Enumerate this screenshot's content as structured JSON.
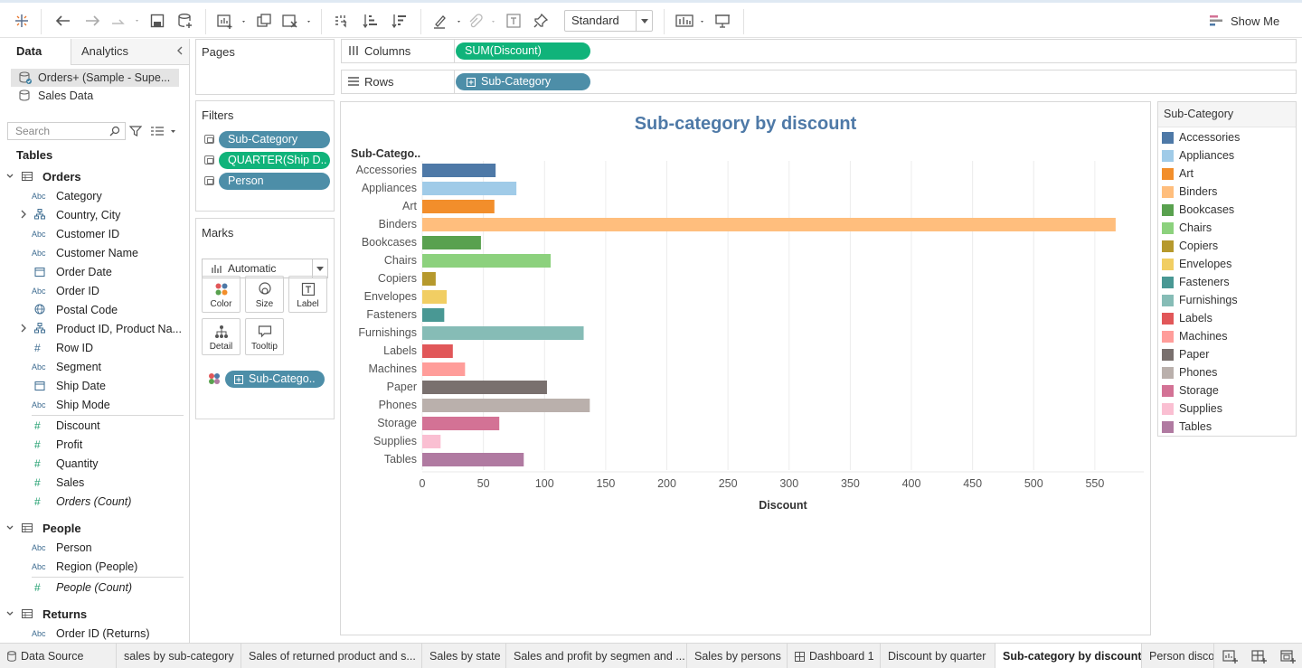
{
  "toolbar": {
    "mark_type_select": "Standard",
    "show_me": "Show Me"
  },
  "left_pane": {
    "tab_data": "Data",
    "tab_analytics": "Analytics",
    "data_sources": [
      "Orders+ (Sample - Supe...",
      "Sales Data"
    ],
    "search_placeholder": "Search",
    "tables_heading": "Tables",
    "tables": [
      {
        "name": "Orders",
        "fields": [
          {
            "type": "Abc",
            "name": "Category"
          },
          {
            "type": "geo",
            "name": "Country, City",
            "expand": true
          },
          {
            "type": "Abc",
            "name": "Customer ID"
          },
          {
            "type": "Abc",
            "name": "Customer Name"
          },
          {
            "type": "date",
            "name": "Order Date"
          },
          {
            "type": "Abc",
            "name": "Order ID"
          },
          {
            "type": "globe",
            "name": "Postal Code"
          },
          {
            "type": "geo",
            "name": "Product ID, Product Na...",
            "expand": true
          },
          {
            "type": "#",
            "name": "Row ID"
          },
          {
            "type": "Abc",
            "name": "Segment"
          },
          {
            "type": "date",
            "name": "Ship Date"
          },
          {
            "type": "Abc",
            "name": "Ship Mode"
          }
        ],
        "measures": [
          "Discount",
          "Profit",
          "Quantity",
          "Sales",
          "Orders (Count)"
        ]
      },
      {
        "name": "People",
        "fields": [
          {
            "type": "Abc",
            "name": "Person"
          },
          {
            "type": "Abc",
            "name": "Region (People)"
          }
        ],
        "measures": [
          "People (Count)"
        ]
      },
      {
        "name": "Returns",
        "fields": [
          {
            "type": "Abc",
            "name": "Order ID (Returns)"
          }
        ],
        "measures": []
      }
    ]
  },
  "cards": {
    "pages": "Pages",
    "filters": "Filters",
    "filter_pills": [
      "Sub-Category",
      "QUARTER(Ship D..",
      "Person"
    ],
    "marks": "Marks",
    "mark_type": "Automatic",
    "mark_buttons": [
      "Color",
      "Size",
      "Label",
      "Detail",
      "Tooltip"
    ],
    "marks_pill": "Sub-Catego.."
  },
  "shelves": {
    "columns_label": "Columns",
    "columns_pill": "SUM(Discount)",
    "rows_label": "Rows",
    "rows_pill": "Sub-Category"
  },
  "chart_data": {
    "type": "bar",
    "orientation": "horizontal",
    "title": "Sub-category by discount",
    "row_header": "Sub-Catego..",
    "xlabel": "Discount",
    "xlim": [
      0,
      590
    ],
    "xticks": [
      0,
      50,
      100,
      150,
      200,
      250,
      300,
      350,
      400,
      450,
      500,
      550
    ],
    "grid": true,
    "categories": [
      "Accessories",
      "Appliances",
      "Art",
      "Binders",
      "Bookcases",
      "Chairs",
      "Copiers",
      "Envelopes",
      "Fasteners",
      "Furnishings",
      "Labels",
      "Machines",
      "Paper",
      "Phones",
      "Storage",
      "Supplies",
      "Tables"
    ],
    "values": [
      60,
      77,
      59,
      567,
      48,
      105,
      11,
      20,
      18,
      132,
      25,
      35,
      102,
      137,
      63,
      15,
      83
    ],
    "colors": [
      "#4e79a7",
      "#a0cbe8",
      "#f28e2b",
      "#ffbe7d",
      "#59a14f",
      "#8cd17d",
      "#b6992d",
      "#f1ce63",
      "#499894",
      "#86bcb6",
      "#e15759",
      "#ff9d9a",
      "#79706e",
      "#bab0ac",
      "#d37295",
      "#fabfd2",
      "#b07aa1"
    ]
  },
  "legend": {
    "title": "Sub-Category"
  },
  "bottom_tabs": [
    {
      "label": "Data Source",
      "icon": "db"
    },
    {
      "label": "sales by sub-category"
    },
    {
      "label": "Sales of returned product and s..."
    },
    {
      "label": "Sales by state"
    },
    {
      "label": "Sales and profit by segmen and ..."
    },
    {
      "label": "Sales by persons"
    },
    {
      "label": "Dashboard 1",
      "icon": "dash"
    },
    {
      "label": "Discount by quarter"
    },
    {
      "label": "Sub-category by discount",
      "active": true
    },
    {
      "label": "Person disco"
    }
  ]
}
